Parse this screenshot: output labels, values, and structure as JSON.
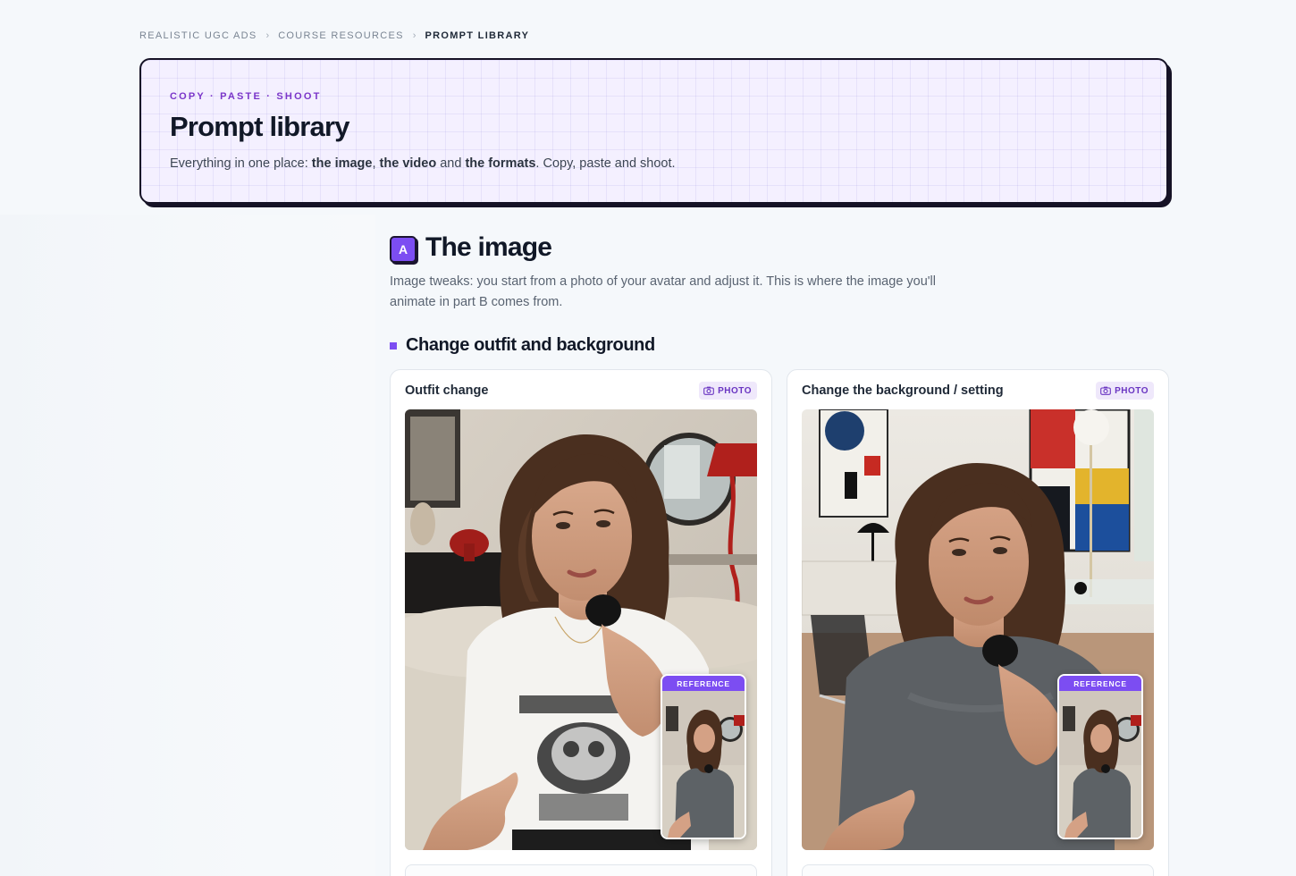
{
  "breadcrumb": {
    "items": [
      "REALISTIC UGC ADS",
      "COURSE RESOURCES"
    ],
    "current": "PROMPT LIBRARY",
    "separator": "›"
  },
  "hero": {
    "eyebrow": "COPY · PASTE · SHOOT",
    "title": "Prompt library",
    "lead": {
      "prefix": "Everything in one place: ",
      "bold1": "the image",
      "comma": ", ",
      "bold2": "the video",
      "and": " and ",
      "bold3": "the formats",
      "suffix": ". Copy, paste and shoot."
    }
  },
  "section": {
    "badge": "A",
    "title": "The image",
    "description": "Image tweaks: you start from a photo of your avatar and adjust it. This is where the image you'll animate in part B comes from."
  },
  "subsection": {
    "title": "Change outfit and background"
  },
  "cards": [
    {
      "title": "Outfit change",
      "tag": "PHOTO",
      "tag_icon": "camera-icon",
      "reference_label": "REFERENCE"
    },
    {
      "title": "Change the background / setting",
      "tag": "PHOTO",
      "tag_icon": "camera-icon",
      "reference_label": "REFERENCE"
    }
  ],
  "colors": {
    "accent": "#7c4df2",
    "eyebrow": "#7a35c9",
    "hero_bg": "#f4f0ff",
    "border_dark": "#161326"
  }
}
